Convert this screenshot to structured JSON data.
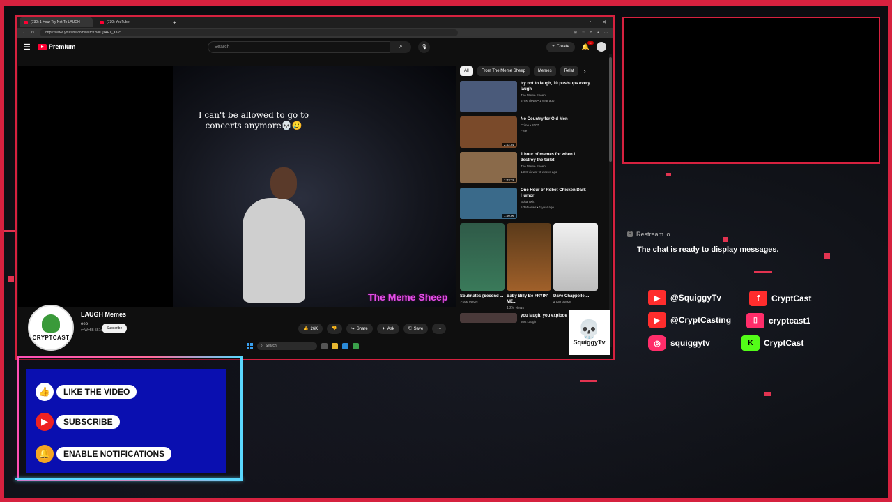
{
  "browser": {
    "tabs": [
      {
        "label": "(730) 1 Hour Try Not To LAUGH"
      },
      {
        "label": "(730) YouTube"
      }
    ],
    "new_tab": "+",
    "url": "https://www.youtube.com/watch?v=Ojz4E1_XKjc",
    "win_min": "–",
    "win_max": "▫",
    "win_close": "✕"
  },
  "youtube": {
    "logo_text": "Premium",
    "search_placeholder": "Search",
    "create_label": "Create",
    "notif_badge": "9+"
  },
  "video": {
    "caption": "I can't be allowed to go to concerts anymore💀🥲",
    "watermark": "The Meme Sheep",
    "title_fragment": "LAUGH Memes",
    "channel_fragment": "eep",
    "channel_sub_fragment": "v=Wv5B 551xkJ",
    "subscribe_label": "Subscribe",
    "like_count": "26K",
    "share_label": "Share",
    "ask_label": "Ask",
    "save_label": "Save",
    "more": "···"
  },
  "chips": [
    "All",
    "From The Meme Sheep",
    "Memes",
    "Relat"
  ],
  "recommendations": [
    {
      "title": "try not to laugh, 10 push-ups every laugh",
      "channel": "The Meme Sheep",
      "meta": "678K views • 1 year ago",
      "duration": "",
      "color": "#4a5a7a"
    },
    {
      "title": "No Country for Old Men",
      "channel": "Crime • 2007",
      "meta": "Free",
      "duration": "2:02:01",
      "color": "#7a4a2a"
    },
    {
      "title": "1 hour of memes for when i destroy the toilet",
      "channel": "The Meme Sheep",
      "meta": "140K views • 3 weeks ago",
      "duration": "1:03:28",
      "color": "#8a6a4a"
    },
    {
      "title": "One Hour of Robot Chicken Dark Humor",
      "channel": "Bolta Twit",
      "meta": "5.3M views • 1 year ago",
      "duration": "1:00:06",
      "color": "#3a6a8a"
    }
  ],
  "shorts": [
    {
      "title": "Soulmates (Second ...",
      "views": "236K views",
      "color": "#3a7a5a"
    },
    {
      "title": "Baby Billy Be FRYIN' ME...",
      "views": "1.2M views",
      "color": "#a0602a"
    },
    {
      "title": "Dave Chappelle ...",
      "views": "4.6M views",
      "color": "#d8d8d8"
    }
  ],
  "next_rec_title": "you laugh, you explode",
  "next_rec_channel": "Just Laugh",
  "taskbar": {
    "search": "Search"
  },
  "logos": {
    "cryptcast": "CRYPTCAST",
    "squiggy": "SquiggyTv"
  },
  "chat": {
    "source": "Restream.io",
    "message": "The chat is ready to display messages."
  },
  "socials": [
    {
      "platform": "youtube",
      "handle": "@SquiggyTv",
      "color": "#ff2d2d"
    },
    {
      "platform": "youtube",
      "handle": "@CryptCasting",
      "color": "#ff2d2d"
    },
    {
      "platform": "instagram",
      "handle": "squiggytv",
      "color": "#ff2d6a"
    },
    {
      "platform": "facebook",
      "handle": "CryptCast",
      "color": "#ff2d2d"
    },
    {
      "platform": "twitch",
      "handle": "cryptcast1",
      "color": "#ff2d6a"
    },
    {
      "platform": "kick",
      "handle": "CryptCast",
      "color": "#53fc18"
    }
  ],
  "cta": {
    "like": "LIKE THE VIDEO",
    "subscribe": "SUBSCRIBE",
    "notify": "ENABLE NOTIFICATIONS"
  },
  "accent": "#d6213f"
}
